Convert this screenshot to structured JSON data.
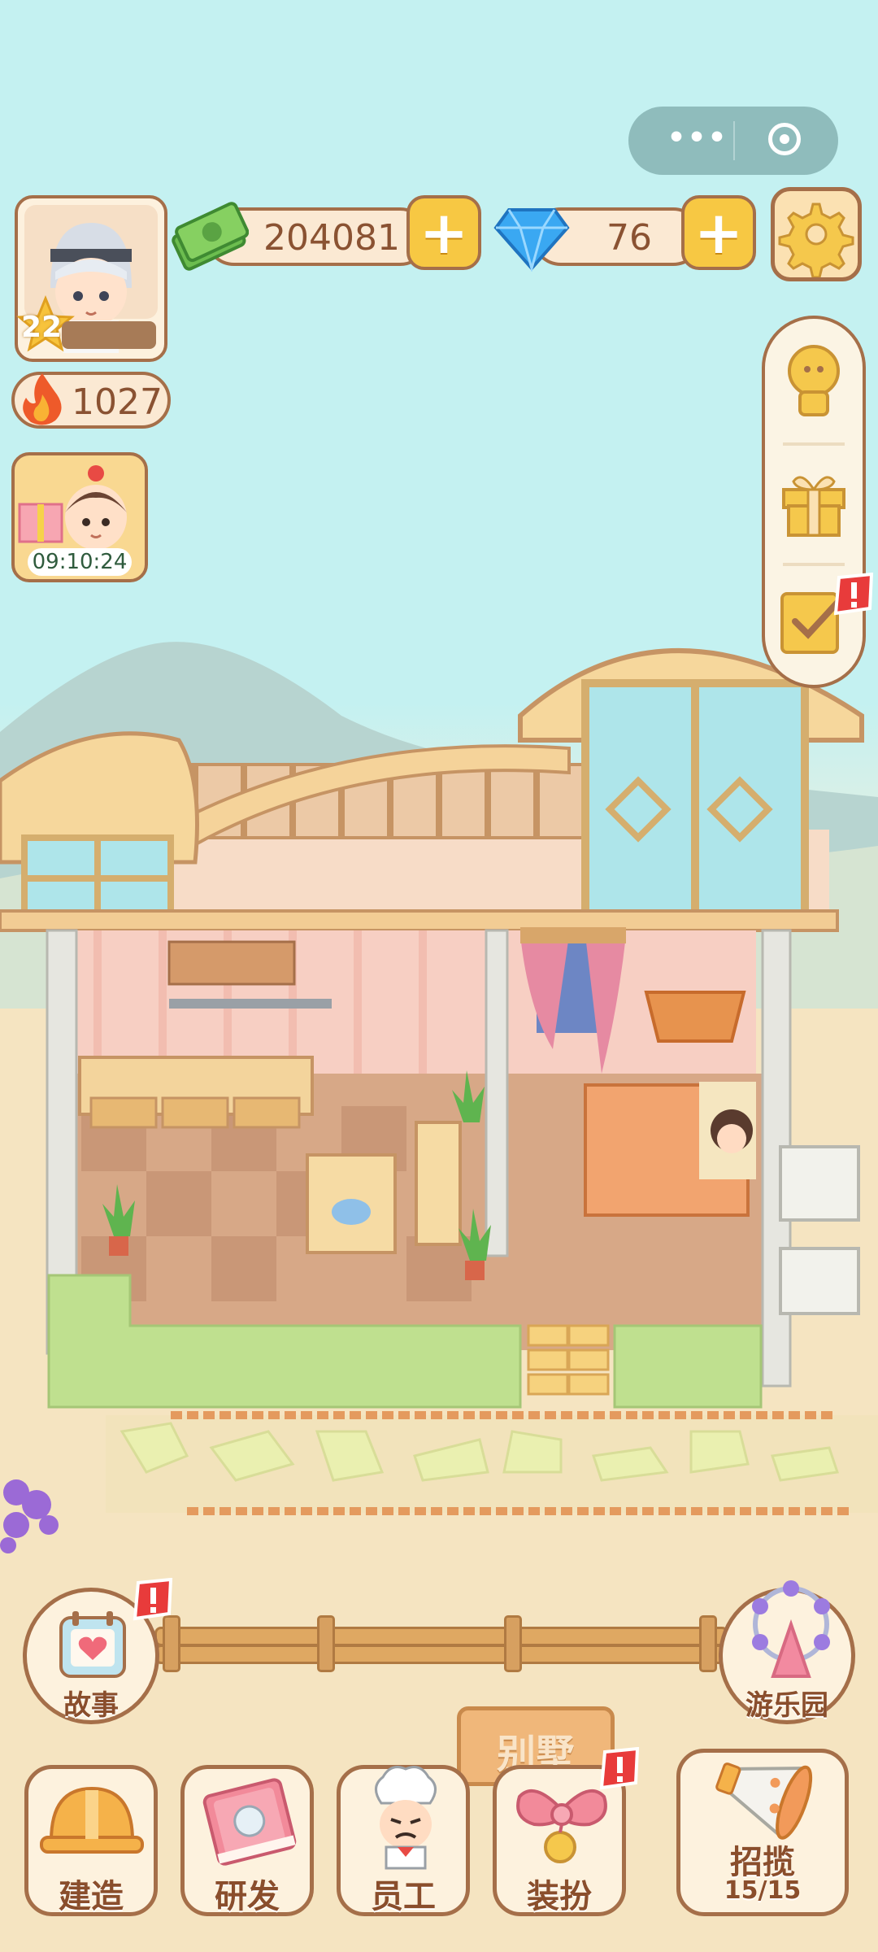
{
  "colors": {
    "sky": "#c4f1f1",
    "sand": "#f5e4c1",
    "frame_brown": "#a56f49",
    "button_gold": "#f7c843",
    "badge_red": "#e83b3b",
    "label_brown": "#8a4e2c"
  },
  "player": {
    "level": "22",
    "heat": "1027",
    "avatar_icon": "player-avatar"
  },
  "currency": {
    "cash": "204081",
    "diamonds": "76"
  },
  "event": {
    "timer": "09:10:24"
  },
  "side_menu": [
    {
      "icon": "ranking-icon"
    },
    {
      "icon": "gift-icon"
    },
    {
      "icon": "tasks-icon",
      "alert": true
    }
  ],
  "scene": {
    "sign_text": "别墅"
  },
  "buttons": {
    "story": "故事",
    "amusement_park": "游乐园",
    "build": "建造",
    "research": "研发",
    "staff": "员工",
    "dress_up": "装扮",
    "recruit": "招揽",
    "recruit_count": "15/15"
  }
}
